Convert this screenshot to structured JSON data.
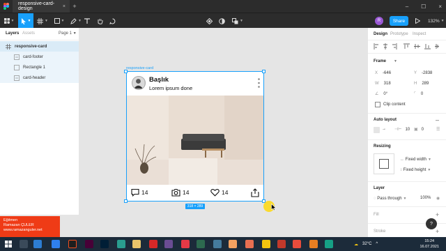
{
  "tabbar": {
    "file_tab": "responsive-card-design",
    "close": "×",
    "add": "+",
    "win_min": "–",
    "win_max": "☐",
    "win_close": "×"
  },
  "toolbar": {
    "share": "Share",
    "avatar_initial": "R",
    "zoom": "132%"
  },
  "left_panel": {
    "tabs": [
      "Layers",
      "Assets"
    ],
    "page": "Page 1",
    "layers": [
      "responsive-card",
      "card-footer",
      "Rectangle 1",
      "card-header"
    ]
  },
  "canvas": {
    "frame_label": "responsive-card",
    "card": {
      "title": "Başlık",
      "subtitle": "Lorem ipsum done"
    },
    "footer": {
      "comments": "14",
      "photos": "14",
      "likes": "14"
    },
    "size_badge": "318 × 289"
  },
  "instructor": {
    "line1": "Eğitmen",
    "line2": "Ramazan ÇULER",
    "line3": "www.ramazanguler.net"
  },
  "right_panel": {
    "tabs": [
      "Design",
      "Prototype",
      "Inspect"
    ],
    "frame_title": "Frame",
    "x_label": "X",
    "x": "-646",
    "y_label": "Y",
    "y": "-2838",
    "w_label": "W",
    "w": "318",
    "h_label": "H",
    "h": "289",
    "rotation": "0°",
    "radius": "0",
    "clip_content": "Clip content",
    "auto_layout": "Auto layout",
    "spacing": "10",
    "padding": "0",
    "resizing": "Resizing",
    "fixed_width": "Fixed width",
    "fixed_height": "Fixed height",
    "layer": "Layer",
    "pass_through": "Pass through",
    "opacity": "100%",
    "fill": "Fill",
    "stroke": "Stroke",
    "help": "?"
  },
  "taskbar": {
    "temp": "32°C",
    "time": "15:24",
    "date": "16.07.2021"
  },
  "colors": {
    "accent": "#18a0fb",
    "dark": "#2c2c2c",
    "instructor": "#ef3b16"
  }
}
